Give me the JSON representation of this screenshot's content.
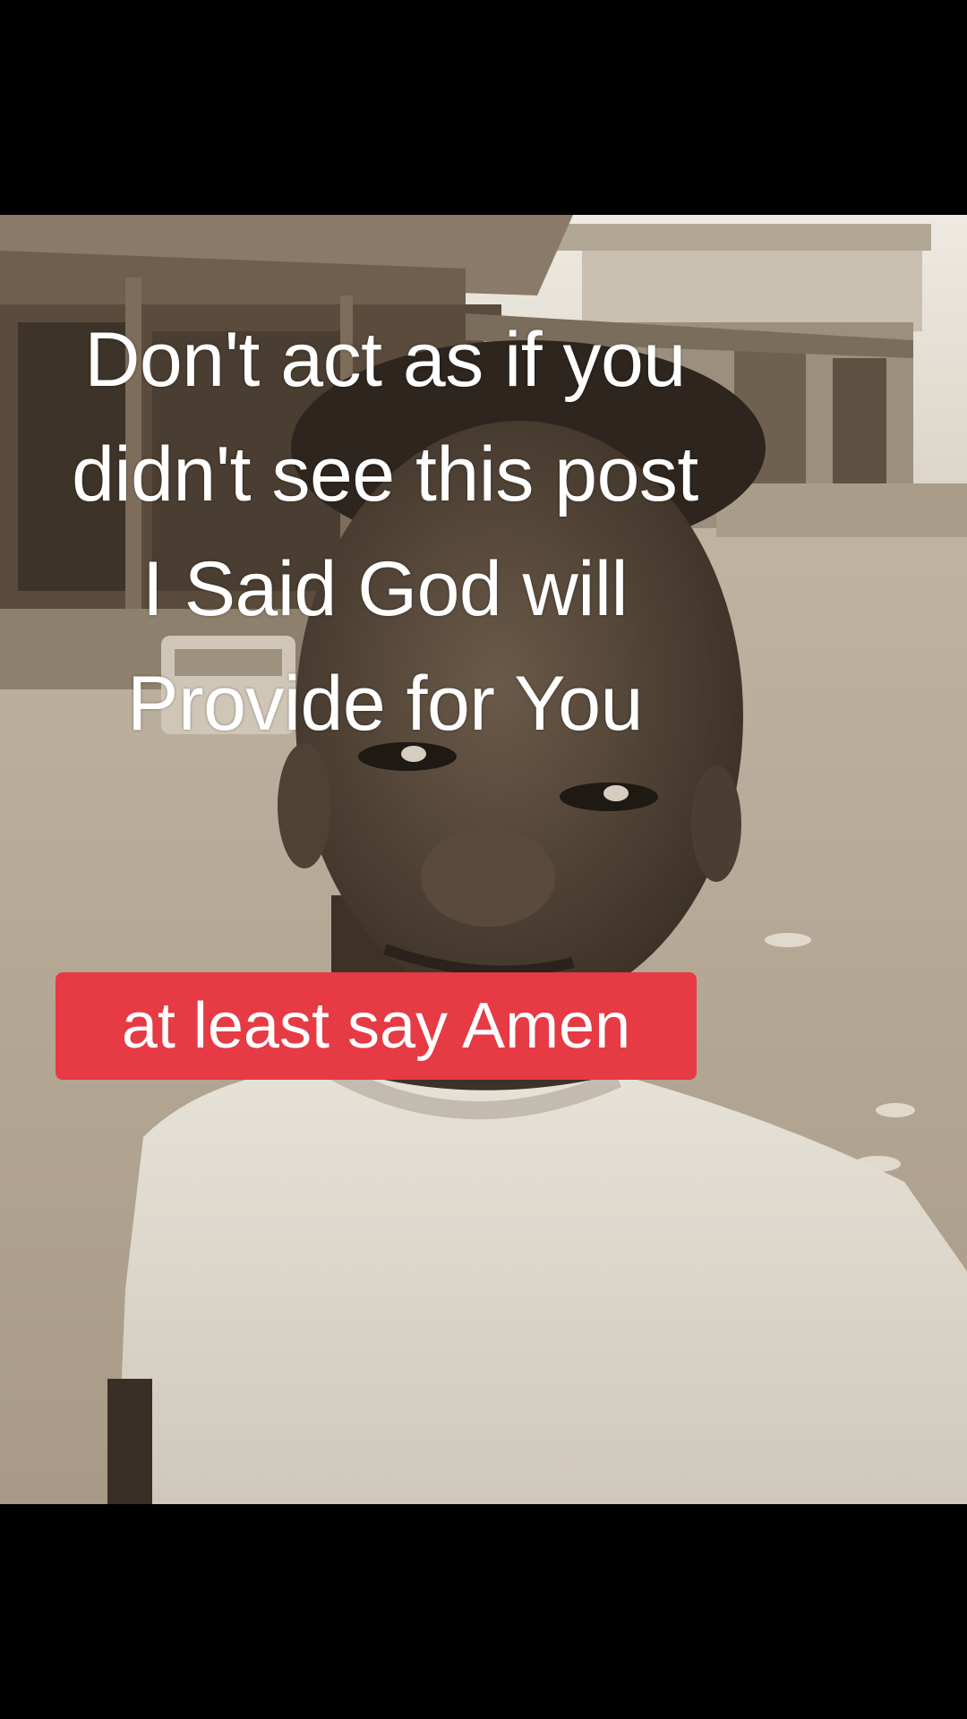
{
  "overlay": {
    "lines": [
      "Don't act as if you",
      "didn't see this post",
      "I Said God will",
      "Provide for You"
    ],
    "badge_text": "at least say Amen"
  },
  "colors": {
    "background": "#000000",
    "badge": "#e63a44",
    "text": "#ffffff",
    "sepia_light": "#d2c8b8",
    "sepia_dark": "#3e342a"
  }
}
